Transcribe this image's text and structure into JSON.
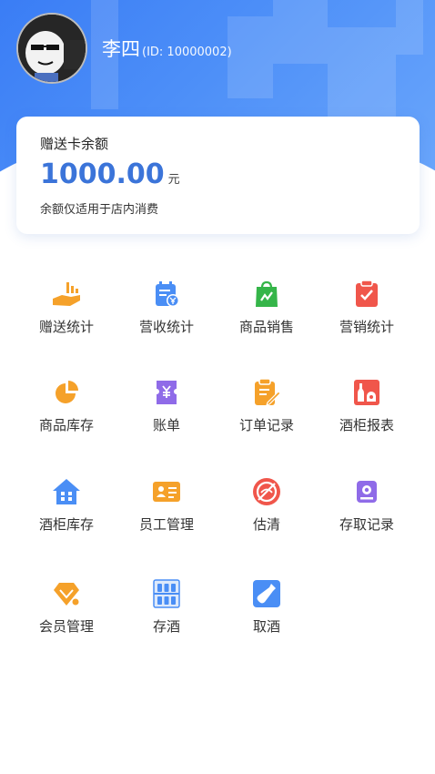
{
  "user": {
    "name": "李四",
    "id_text": "(ID: 10000002)"
  },
  "balance_card": {
    "title": "赠送卡余额",
    "amount": "1000.00",
    "unit": "元",
    "note": "余额仅适用于店内消费"
  },
  "menu": [
    {
      "label": "赠送统计",
      "icon": "gift-hand-icon",
      "color": "#f5a12a"
    },
    {
      "label": "营收统计",
      "icon": "calendar-yen-icon",
      "color": "#4a8ef5"
    },
    {
      "label": "商品销售",
      "icon": "shopping-bag-icon",
      "color": "#35b549"
    },
    {
      "label": "营销统计",
      "icon": "clipboard-check-icon",
      "color": "#f0564b"
    },
    {
      "label": "商品库存",
      "icon": "pie-chart-icon",
      "color": "#f5a12a"
    },
    {
      "label": "账单",
      "icon": "ticket-yen-icon",
      "color": "#8f6be8"
    },
    {
      "label": "订单记录",
      "icon": "clipboard-edit-icon",
      "color": "#f5a12a"
    },
    {
      "label": "酒柜报表",
      "icon": "bottle-cabinet-icon",
      "color": "#f0564b"
    },
    {
      "label": "酒柜库存",
      "icon": "house-icon",
      "color": "#4a8ef5"
    },
    {
      "label": "员工管理",
      "icon": "id-card-icon",
      "color": "#f5a12a"
    },
    {
      "label": "估清",
      "icon": "prohibited-icon",
      "color": "#f0564b"
    },
    {
      "label": "存取记录",
      "icon": "storage-box-icon",
      "color": "#8f6be8"
    },
    {
      "label": "会员管理",
      "icon": "diamond-icon",
      "color": "#f5a12a"
    },
    {
      "label": "存酒",
      "icon": "wine-shelf-icon",
      "color": "#4a8ef5"
    },
    {
      "label": "取酒",
      "icon": "wine-bottle-icon",
      "color": "#4a8ef5"
    }
  ]
}
